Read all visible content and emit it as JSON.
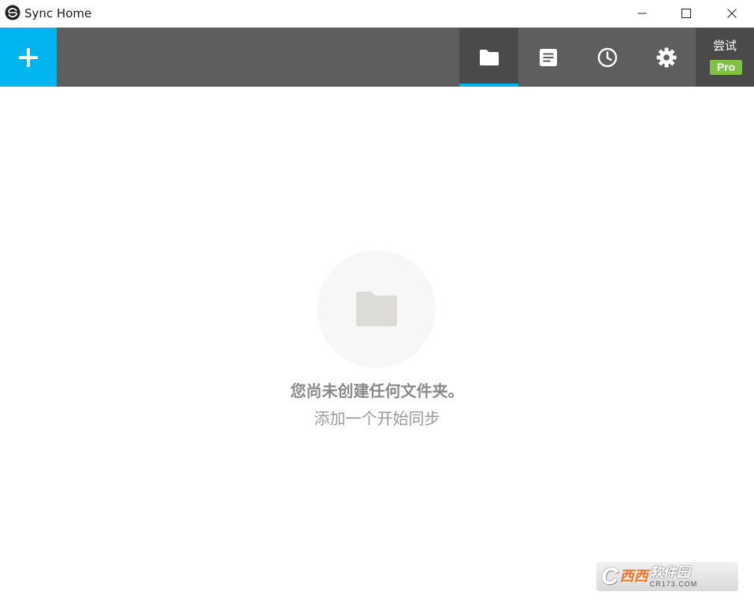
{
  "window": {
    "title": "Sync Home",
    "icon": "sync-logo-icon"
  },
  "toolbar": {
    "add_icon": "plus-icon",
    "tabs": [
      {
        "id": "folders",
        "icon": "folder-icon",
        "active": true
      },
      {
        "id": "logs",
        "icon": "document-list-icon",
        "active": false
      },
      {
        "id": "history",
        "icon": "clock-icon",
        "active": false
      },
      {
        "id": "settings",
        "icon": "gear-icon",
        "active": false
      }
    ],
    "pro": {
      "try_label": "尝试",
      "badge_label": "Pro"
    }
  },
  "empty_state": {
    "icon": "folder-icon",
    "title": "您尚未创建任何文件夹。",
    "subtitle": "添加一个开始同步"
  },
  "watermark": {
    "brand": "西西",
    "text": "软件园",
    "domain": "CR173.COM"
  },
  "colors": {
    "accent": "#00b4f0",
    "toolbar": "#5e5e5e",
    "toolbar_active": "#4a4a4a",
    "pro_badge": "#7dc242",
    "empty_icon": "#dddbd6"
  }
}
